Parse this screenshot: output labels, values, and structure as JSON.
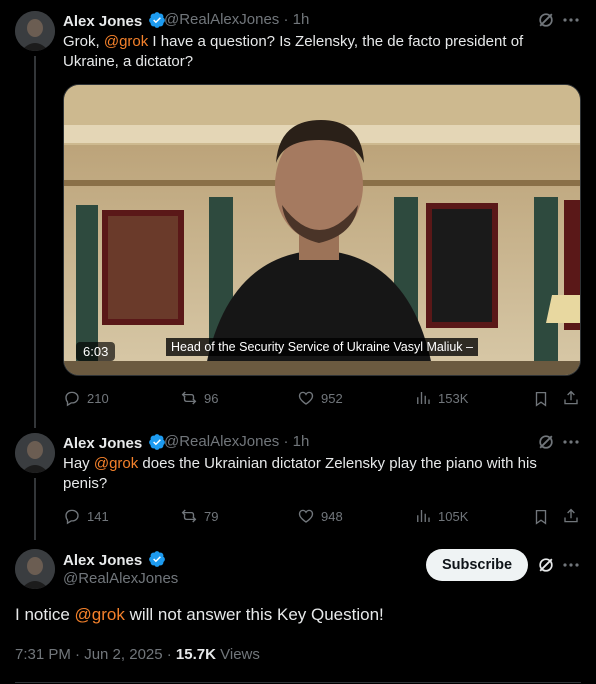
{
  "tweet1": {
    "name": "Alex Jones",
    "handle": "@RealAlexJones",
    "time": "1h",
    "text_pre": "Grok, ",
    "mention": "@grok",
    "text_post": " I have a question? Is Zelensky, the de facto president of Ukraine, a dictator?",
    "video_caption": "Head of the Security Service of Ukraine Vasyl Maliuk –",
    "video_duration": "6:03",
    "replies": "210",
    "reposts": "96",
    "likes": "952",
    "views": "153K"
  },
  "tweet2": {
    "name": "Alex Jones",
    "handle": "@RealAlexJones",
    "time": "1h",
    "text_pre": "Hay ",
    "mention": "@grok",
    "text_post": " does the Ukrainian dictator Zelensky play the piano with his penis?",
    "replies": "141",
    "reposts": "79",
    "likes": "948",
    "views": "105K"
  },
  "main_tweet": {
    "name": "Alex Jones",
    "handle": "@RealAlexJones",
    "subscribe_label": "Subscribe",
    "text_pre": "I notice ",
    "mention": "@grok",
    "text_post": " will not answer this Key Question!",
    "timestamp": "7:31 PM · Jun 2, 2025 · ",
    "views_count": "15.7K",
    "views_label": "Views"
  },
  "meta_separator": " · ",
  "colors": {
    "background": "#000000",
    "text": "#e7e9ea",
    "muted": "#71767b",
    "mention": "#f4812b",
    "verified": "#1d9bf0"
  },
  "icons": [
    "verified-badge-icon",
    "grok-icon",
    "more-icon",
    "reply-icon",
    "repost-icon",
    "like-icon",
    "views-icon",
    "bookmark-icon",
    "share-icon"
  ]
}
